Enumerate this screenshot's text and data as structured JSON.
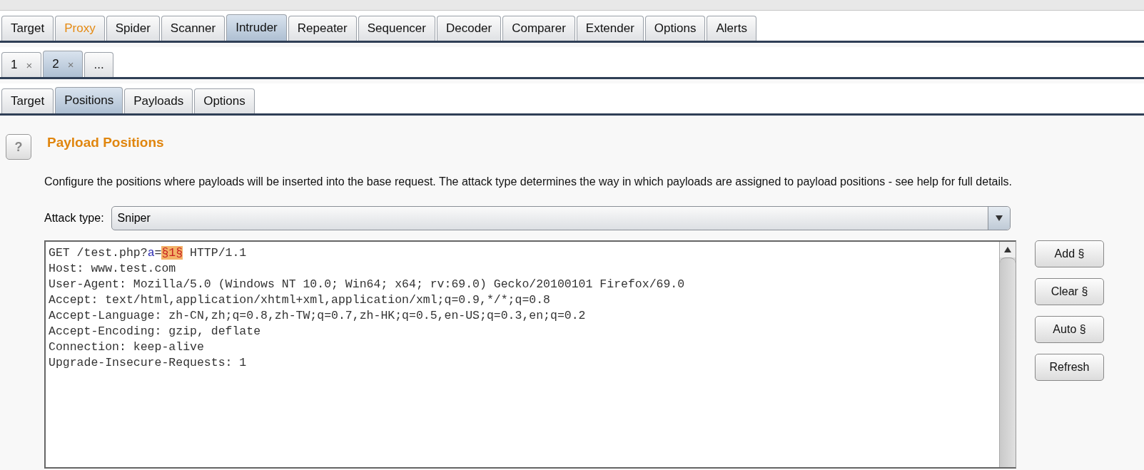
{
  "main_tabs": [
    {
      "label": "Target",
      "selected": false,
      "highlighted": false
    },
    {
      "label": "Proxy",
      "selected": false,
      "highlighted": true
    },
    {
      "label": "Spider",
      "selected": false,
      "highlighted": false
    },
    {
      "label": "Scanner",
      "selected": false,
      "highlighted": false
    },
    {
      "label": "Intruder",
      "selected": true,
      "highlighted": false
    },
    {
      "label": "Repeater",
      "selected": false,
      "highlighted": false
    },
    {
      "label": "Sequencer",
      "selected": false,
      "highlighted": false
    },
    {
      "label": "Decoder",
      "selected": false,
      "highlighted": false
    },
    {
      "label": "Comparer",
      "selected": false,
      "highlighted": false
    },
    {
      "label": "Extender",
      "selected": false,
      "highlighted": false
    },
    {
      "label": "Options",
      "selected": false,
      "highlighted": false
    },
    {
      "label": "Alerts",
      "selected": false,
      "highlighted": false
    }
  ],
  "attack_tabs": [
    {
      "label": "1",
      "close": "×",
      "selected": false
    },
    {
      "label": "2",
      "close": "×",
      "selected": true
    },
    {
      "label": "...",
      "selected": false
    }
  ],
  "sub_tabs": [
    {
      "label": "Target",
      "selected": false
    },
    {
      "label": "Positions",
      "selected": true
    },
    {
      "label": "Payloads",
      "selected": false
    },
    {
      "label": "Options",
      "selected": false
    }
  ],
  "help_button": "?",
  "section_title": "Payload Positions",
  "description": "Configure the positions where payloads will be inserted into the base request. The attack type determines the way in which payloads are assigned to payload positions - see help for full details.",
  "attack_type": {
    "label": "Attack type:",
    "value": "Sniper"
  },
  "request_lines": [
    [
      {
        "kind": "plain",
        "text": "GET /test.php?"
      },
      {
        "kind": "param",
        "text": "a"
      },
      {
        "kind": "plain",
        "text": "="
      },
      {
        "kind": "marker",
        "text": "§1§"
      },
      {
        "kind": "plain",
        "text": " HTTP/1.1"
      }
    ],
    [
      {
        "kind": "plain",
        "text": "Host: www.test.com"
      }
    ],
    [
      {
        "kind": "plain",
        "text": "User-Agent: Mozilla/5.0 (Windows NT 10.0; Win64; x64; rv:69.0) Gecko/20100101 Firefox/69.0"
      }
    ],
    [
      {
        "kind": "plain",
        "text": "Accept: text/html,application/xhtml+xml,application/xml;q=0.9,*/*;q=0.8"
      }
    ],
    [
      {
        "kind": "plain",
        "text": "Accept-Language: zh-CN,zh;q=0.8,zh-TW;q=0.7,zh-HK;q=0.5,en-US;q=0.3,en;q=0.2"
      }
    ],
    [
      {
        "kind": "plain",
        "text": "Accept-Encoding: gzip, deflate"
      }
    ],
    [
      {
        "kind": "plain",
        "text": "Connection: keep-alive"
      }
    ],
    [
      {
        "kind": "plain",
        "text": "Upgrade-Insecure-Requests: 1"
      }
    ]
  ],
  "side_buttons": [
    "Add §",
    "Clear §",
    "Auto §",
    "Refresh"
  ]
}
